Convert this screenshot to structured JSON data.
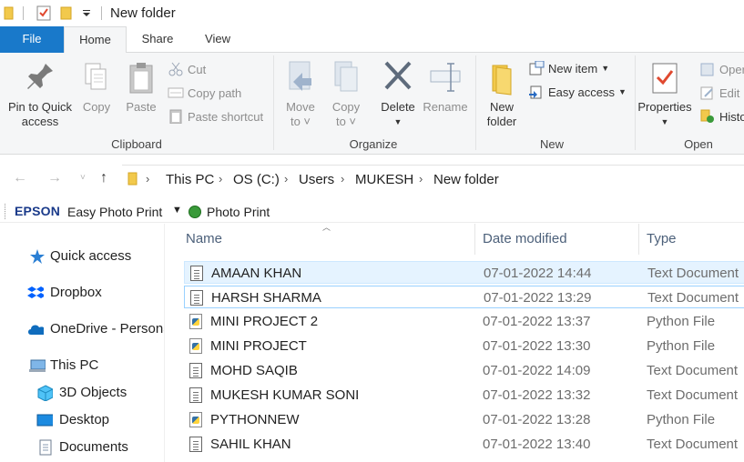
{
  "window": {
    "title": "New folder"
  },
  "tabs": [
    {
      "label": "File"
    },
    {
      "label": "Home"
    },
    {
      "label": "Share"
    },
    {
      "label": "View"
    }
  ],
  "ribbon": {
    "clipboard": {
      "group_label": "Clipboard",
      "pin_label_1": "Pin to Quick",
      "pin_label_2": "access",
      "copy_label": "Copy",
      "paste_label": "Paste",
      "cut_label": "Cut",
      "copy_path_label": "Copy path",
      "paste_shortcut_label": "Paste shortcut"
    },
    "organize": {
      "group_label": "Organize",
      "move_label_1": "Move",
      "move_label_2": "to",
      "copy_label_1": "Copy",
      "copy_label_2": "to",
      "delete_label": "Delete",
      "rename_label": "Rename"
    },
    "new": {
      "group_label": "New",
      "new_folder_label_1": "New",
      "new_folder_label_2": "folder",
      "new_item_label": "New item",
      "easy_access_label": "Easy access"
    },
    "open": {
      "group_label": "Open",
      "properties_label": "Properties",
      "open_label": "Oper",
      "edit_label": "Edit",
      "history_label": "Histo"
    }
  },
  "address": {
    "crumbs": [
      "This PC",
      "OS (C:)",
      "Users",
      "MUKESH",
      "New folder"
    ]
  },
  "epson": {
    "logo": "EPSON",
    "easy_photo_print": "Easy Photo Print",
    "photo_print": "Photo Print"
  },
  "nav": {
    "items": [
      {
        "label": "Quick access"
      },
      {
        "label": "Dropbox"
      },
      {
        "label": "OneDrive - Persona"
      },
      {
        "label": "This PC"
      },
      {
        "label": "3D Objects"
      },
      {
        "label": "Desktop"
      },
      {
        "label": "Documents"
      }
    ]
  },
  "columns": {
    "name": "Name",
    "date": "Date modified",
    "type": "Type"
  },
  "files": [
    {
      "name": "AMAAN KHAN",
      "date": "07-01-2022 14:44",
      "type": "Text Document",
      "kind": "text"
    },
    {
      "name": "HARSH SHARMA",
      "date": "07-01-2022 13:29",
      "type": "Text Document",
      "kind": "text"
    },
    {
      "name": "MINI PROJECT 2",
      "date": "07-01-2022 13:37",
      "type": "Python File",
      "kind": "python"
    },
    {
      "name": "MINI PROJECT",
      "date": "07-01-2022 13:30",
      "type": "Python File",
      "kind": "python"
    },
    {
      "name": "MOHD SAQIB",
      "date": "07-01-2022 14:09",
      "type": "Text Document",
      "kind": "text"
    },
    {
      "name": "MUKESH KUMAR SONI",
      "date": "07-01-2022 13:32",
      "type": "Text Document",
      "kind": "text"
    },
    {
      "name": "PYTHONNEW",
      "date": "07-01-2022 13:28",
      "type": "Python File",
      "kind": "python"
    },
    {
      "name": "SAHIL KHAN",
      "date": "07-01-2022 13:40",
      "type": "Text Document",
      "kind": "text"
    }
  ],
  "colors": {
    "accent": "#1979ca",
    "selection": "#e5f3ff",
    "selection_border": "#cde8ff"
  }
}
